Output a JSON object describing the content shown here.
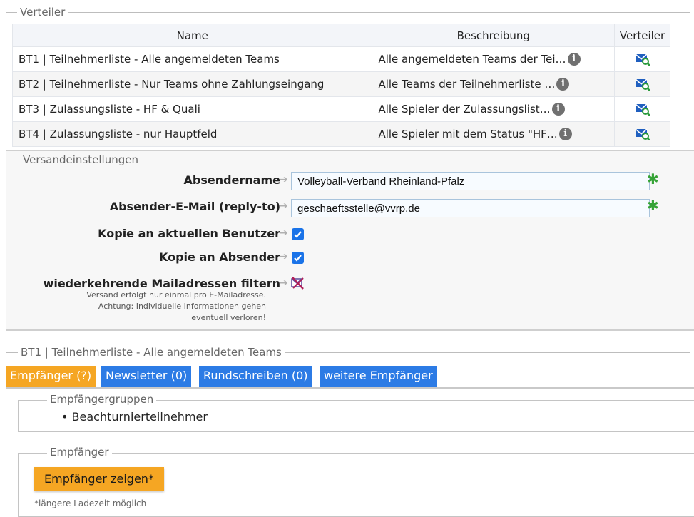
{
  "verteiler": {
    "legend": "Verteiler",
    "headers": {
      "name": "Name",
      "beschreibung": "Beschreibung",
      "verteiler": "Verteiler"
    },
    "rows": [
      {
        "name": "BT1 | Teilnehmerliste - Alle angemeldeten Teams",
        "beschreibung": "Alle angemeldeten Teams der Tei…"
      },
      {
        "name": "BT2 | Teilnehmerliste - Nur Teams ohne Zahlungseingang",
        "beschreibung": "Alle Teams der Teilnehmerliste …"
      },
      {
        "name": "BT3 | Zulassungsliste - HF & Quali",
        "beschreibung": "Alle Spieler der Zulassungslist…"
      },
      {
        "name": "BT4 | Zulassungsliste - nur Hauptfeld",
        "beschreibung": "Alle Spieler mit dem Status \"HF…"
      }
    ]
  },
  "versand": {
    "legend": "Versandeinstellungen",
    "absendername_label": "Absendername",
    "absendername_value": "Volleyball-Verband Rheinland-Pfalz",
    "email_label": "Absender-E-Mail (reply-to)",
    "email_value": "geschaeftsstelle@vvrp.de",
    "kopie_benutzer_label": "Kopie an aktuellen Benutzer",
    "kopie_absender_label": "Kopie an Absender",
    "filter_label": "wiederkehrende Mailadressen filtern",
    "filter_hint_1": "Versand erfolgt nur einmal pro E-Mailadresse.",
    "filter_hint_2": "Achtung: Individuelle Informationen gehen",
    "filter_hint_3": "eventuell verloren!"
  },
  "selected": {
    "legend": "BT1 | Teilnehmerliste - Alle angemeldeten Teams",
    "tabs": [
      "Empfänger (?)",
      "Newsletter (0)",
      "Rundschreiben (0)",
      "weitere Empfänger"
    ],
    "gruppen_legend": "Empfängergruppen",
    "gruppen_item": "Beachturnierteilnehmer",
    "empfaenger_legend": "Empfänger",
    "show_button": "Empfänger zeigen*",
    "note": "*längere Ladezeit möglich"
  },
  "colors": {
    "tab_active": "#f5a623",
    "tab": "#2c7be5",
    "required": "#36a336"
  }
}
